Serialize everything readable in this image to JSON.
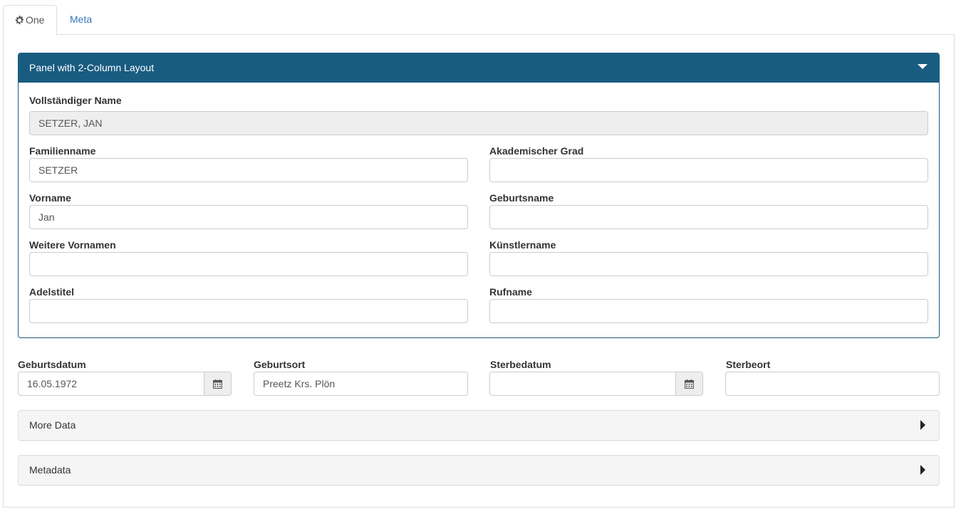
{
  "tabs": [
    {
      "label": "One",
      "icon": "gear-icon",
      "active": true
    },
    {
      "label": "Meta",
      "active": false
    }
  ],
  "panel": {
    "title": "Panel with 2-Column Layout",
    "full_name": {
      "label": "Vollständiger Name",
      "value": "SETZER, JAN"
    },
    "left": [
      {
        "label": "Familienname",
        "value": "SETZER"
      },
      {
        "label": "Vorname",
        "value": "Jan"
      },
      {
        "label": "Weitere Vornamen",
        "value": ""
      },
      {
        "label": "Adelstitel",
        "value": ""
      }
    ],
    "right": [
      {
        "label": "Akademischer Grad",
        "value": ""
      },
      {
        "label": "Geburtsname",
        "value": ""
      },
      {
        "label": "Künstlername",
        "value": ""
      },
      {
        "label": "Rufname",
        "value": ""
      }
    ]
  },
  "dates": {
    "birth_date": {
      "label": "Geburtsdatum",
      "value": "16.05.1972"
    },
    "birth_place": {
      "label": "Geburtsort",
      "value": "Preetz Krs. Plön"
    },
    "death_date": {
      "label": "Sterbedatum",
      "value": ""
    },
    "death_place": {
      "label": "Sterbeort",
      "value": ""
    }
  },
  "collapsibles": [
    {
      "label": "More Data"
    },
    {
      "label": "Metadata"
    }
  ],
  "colors": {
    "panel_header": "#195c81",
    "link": "#337ab7"
  }
}
